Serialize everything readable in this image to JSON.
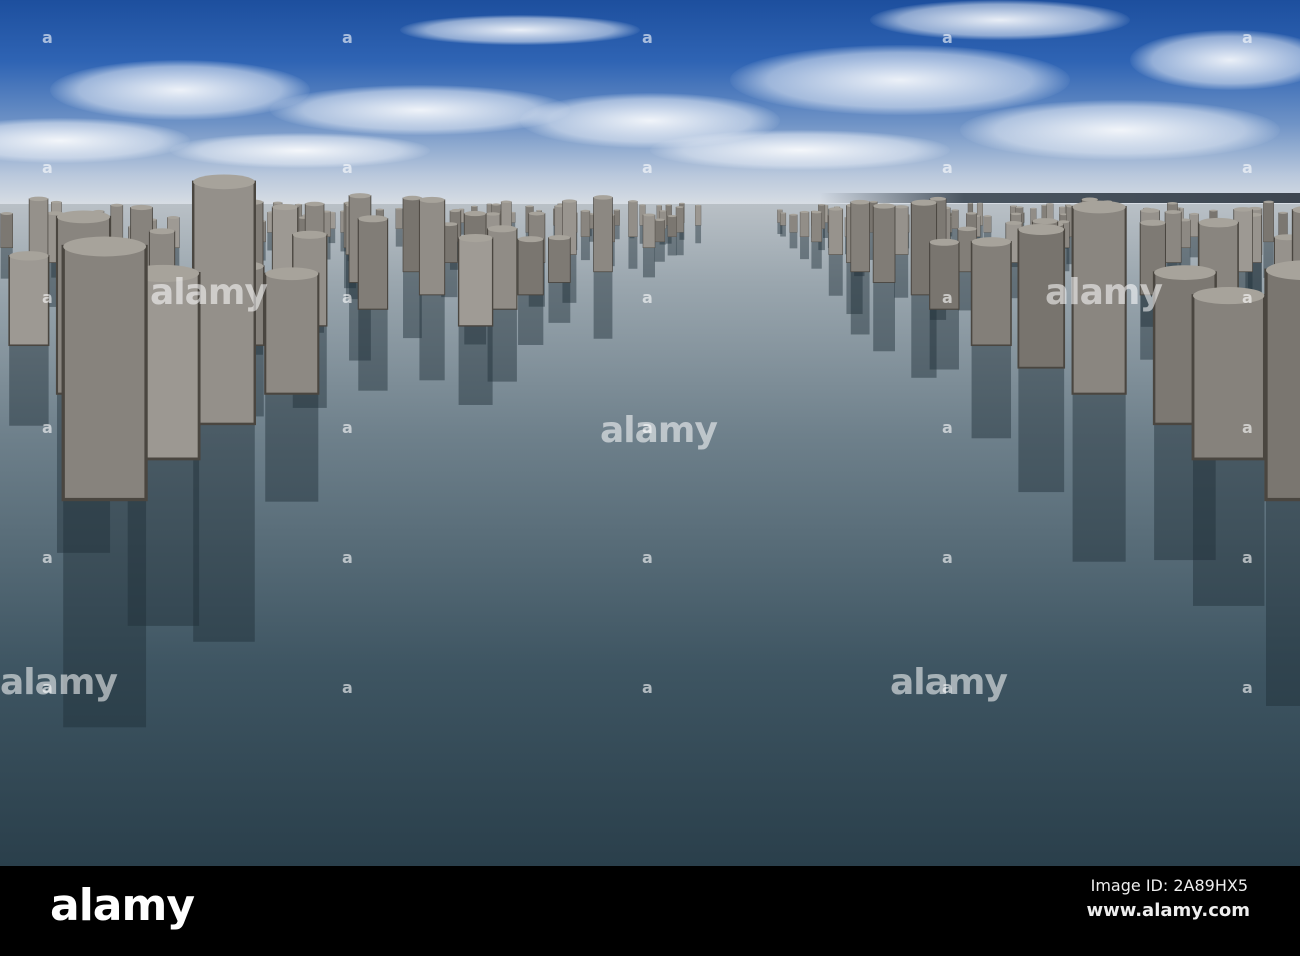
{
  "watermark": {
    "text": "alamy",
    "mark": "a"
  },
  "footer": {
    "logo": "alamy",
    "image_id_label": "Image ID: 2A89HX5",
    "url": "www.alamy.com"
  },
  "colors": {
    "sky": "#2f64b4",
    "water": "#4a606c",
    "post": "#8c8880",
    "bar": "#000000"
  }
}
